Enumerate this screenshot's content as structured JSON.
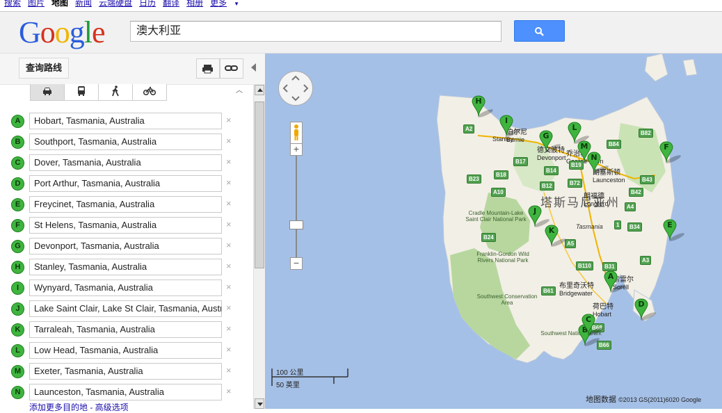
{
  "topnav": {
    "items": [
      {
        "label": "搜索",
        "active": false
      },
      {
        "label": "图片",
        "active": false
      },
      {
        "label": "地图",
        "active": true
      },
      {
        "label": "新闻",
        "active": false
      },
      {
        "label": "云端硬盘",
        "active": false
      },
      {
        "label": "日历",
        "active": false
      },
      {
        "label": "翻译",
        "active": false
      },
      {
        "label": "相册",
        "active": false
      },
      {
        "label": "更多",
        "active": false
      }
    ]
  },
  "header": {
    "logo_letters": [
      {
        "ch": "G",
        "color": "#2a5ddc"
      },
      {
        "ch": "o",
        "color": "#d6321f"
      },
      {
        "ch": "o",
        "color": "#f0b400"
      },
      {
        "ch": "g",
        "color": "#2a5ddc"
      },
      {
        "ch": "l",
        "color": "#1e9b3b"
      },
      {
        "ch": "e",
        "color": "#d6321f"
      }
    ],
    "search_value": "澳大利亚",
    "search_button_color": "#4d90fe"
  },
  "panel": {
    "route_label": "查询路线",
    "modes": [
      {
        "name": "car-icon",
        "active": true
      },
      {
        "name": "transit-icon",
        "active": false
      },
      {
        "name": "walk-icon",
        "active": false
      },
      {
        "name": "bicycle-icon",
        "active": false
      }
    ],
    "waypoints": [
      {
        "letter": "A",
        "value": "Hobart, Tasmania, Australia"
      },
      {
        "letter": "B",
        "value": "Southport, Tasmania, Australia"
      },
      {
        "letter": "C",
        "value": "Dover, Tasmania, Australia"
      },
      {
        "letter": "D",
        "value": "Port Arthur, Tasmania, Australia"
      },
      {
        "letter": "E",
        "value": "Freycinet, Tasmania, Australia"
      },
      {
        "letter": "F",
        "value": "St Helens, Tasmania, Australia"
      },
      {
        "letter": "G",
        "value": "Devonport, Tasmania, Australia"
      },
      {
        "letter": "H",
        "value": "Stanley, Tasmania, Australia"
      },
      {
        "letter": "I",
        "value": "Wynyard, Tasmania, Australia"
      },
      {
        "letter": "J",
        "value": "Lake Saint Clair, Lake St Clair, Tasmania, Australia"
      },
      {
        "letter": "K",
        "value": "Tarraleah, Tasmania, Australia"
      },
      {
        "letter": "L",
        "value": "Low Head, Tasmania, Australia"
      },
      {
        "letter": "M",
        "value": "Exeter, Tasmania, Australia"
      },
      {
        "letter": "N",
        "value": "Launceston, Tasmania, Australia"
      }
    ],
    "remove_symbol": "×",
    "cutoff_text": "添加更多目的地 - 高级选项"
  },
  "map": {
    "colors": {
      "water": "#a5c0e7",
      "land": "#f2efe6",
      "park": "#b7d79f",
      "pin": "#3fb43f"
    },
    "regions": {
      "title": "塔斯马尼亚州",
      "sub": "Tasmania"
    },
    "places": [
      {
        "name": "Stanley",
        "zh": ""
      },
      {
        "zh": "伯尔尼",
        "en": "Burnie"
      },
      {
        "zh": "德文波特",
        "en": "Devonport"
      },
      {
        "zh": "乔治敦",
        "en": "George Town"
      },
      {
        "zh": "朗塞斯顿",
        "en": "Launceston"
      },
      {
        "zh": "朗福德",
        "en": "Longford"
      },
      {
        "zh": "布里奇沃特",
        "en": "Bridgewater"
      },
      {
        "zh": "荷巴特",
        "en": "Hobart"
      },
      {
        "zh": "索雷尔",
        "en": "Sorell"
      }
    ],
    "parks": [
      "Cradle Mountain-Lake Saint Clair National Park",
      "Franklin-Gordon Wild Rivers National Park",
      "Southwest Conservation Area",
      "Southwest National Park"
    ],
    "roads": [
      "A2",
      "B82",
      "B84",
      "B17",
      "B18",
      "B14",
      "B19",
      "B23",
      "A10",
      "B12",
      "B72",
      "B42",
      "B43",
      "A4",
      "B34",
      "B24",
      "A3",
      "A5",
      "B110",
      "B31",
      "B61",
      "B68",
      "B66",
      "1"
    ],
    "pins": [
      "A",
      "B",
      "C",
      "D",
      "E",
      "F",
      "G",
      "H",
      "I",
      "J",
      "K",
      "L",
      "M",
      "N"
    ],
    "scale": {
      "km": "100 公里",
      "mi": "50 英里"
    },
    "attribution": {
      "prefix": "地图数据",
      "rest": "©2013 GS(2011)6020 Google"
    }
  }
}
